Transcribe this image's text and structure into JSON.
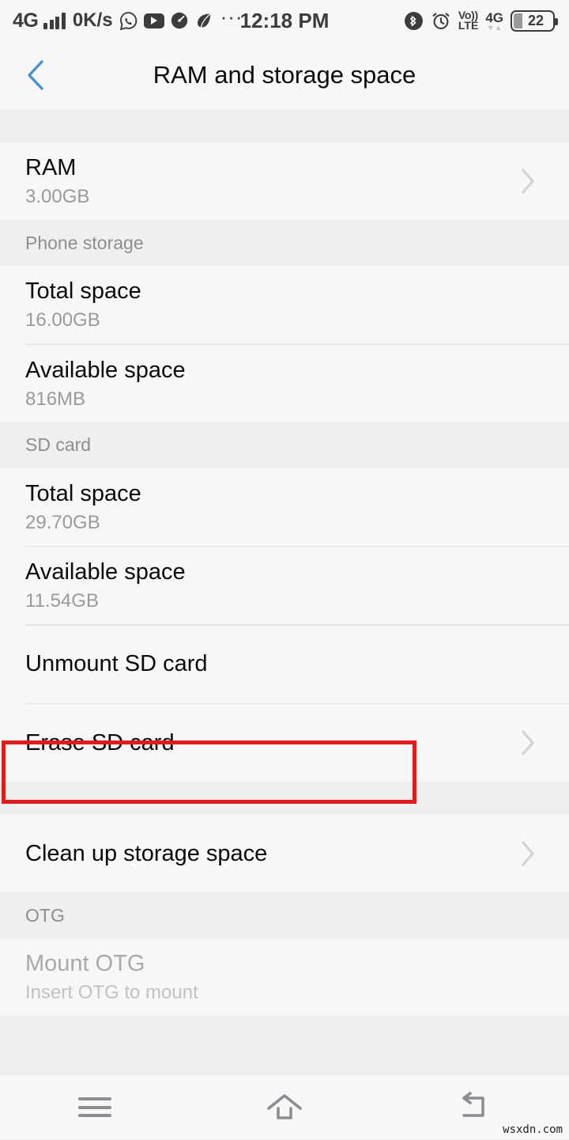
{
  "statusbar": {
    "network_label": "4G",
    "data_speed": "0K/s",
    "time": "12:18 PM",
    "left_icons": [
      "signal-bars-icon",
      "whatsapp-icon",
      "youtube-icon",
      "speedometer-icon",
      "leaf-icon",
      "overflow-dots-icon"
    ],
    "overflow_dots": "···",
    "volte_line1": "Vo))",
    "volte_line2": "LTE",
    "network_right_label": "4G",
    "data_arrow_down": "▼",
    "data_arrow_up": "▲",
    "battery_percent": "22",
    "battery_level": 22,
    "right_icons": [
      "bluetooth-icon",
      "alarm-clock-icon",
      "volte-icon",
      "signal-4g-icon",
      "battery-icon"
    ]
  },
  "appbar": {
    "title": "RAM and storage space",
    "back_icon": "back-chevron-icon",
    "back_icon_color": "#4a90d0"
  },
  "ram": {
    "title": "RAM",
    "value": "3.00GB"
  },
  "phone_storage": {
    "header": "Phone storage",
    "rows": [
      {
        "title": "Total space",
        "value": "16.00GB"
      },
      {
        "title": "Available space",
        "value": "816MB"
      }
    ]
  },
  "sd_card": {
    "header": "SD card",
    "rows": [
      {
        "title": "Total space",
        "value": "29.70GB"
      },
      {
        "title": "Available space",
        "value": "11.54GB"
      }
    ],
    "unmount_label": "Unmount SD card",
    "erase_label": "Erase SD card"
  },
  "cleanup": {
    "label": "Clean up storage space"
  },
  "otg": {
    "header": "OTG",
    "title": "Mount OTG",
    "subtitle": "Insert OTG to mount"
  },
  "annotation": {
    "color": "#e01b1b",
    "target": "Erase SD card"
  },
  "navbar": {
    "menu_icon": "menu-hamburger-icon",
    "home_icon": "home-icon",
    "back_icon": "back-arrow-icon"
  },
  "watermark": "wsxdn.com"
}
